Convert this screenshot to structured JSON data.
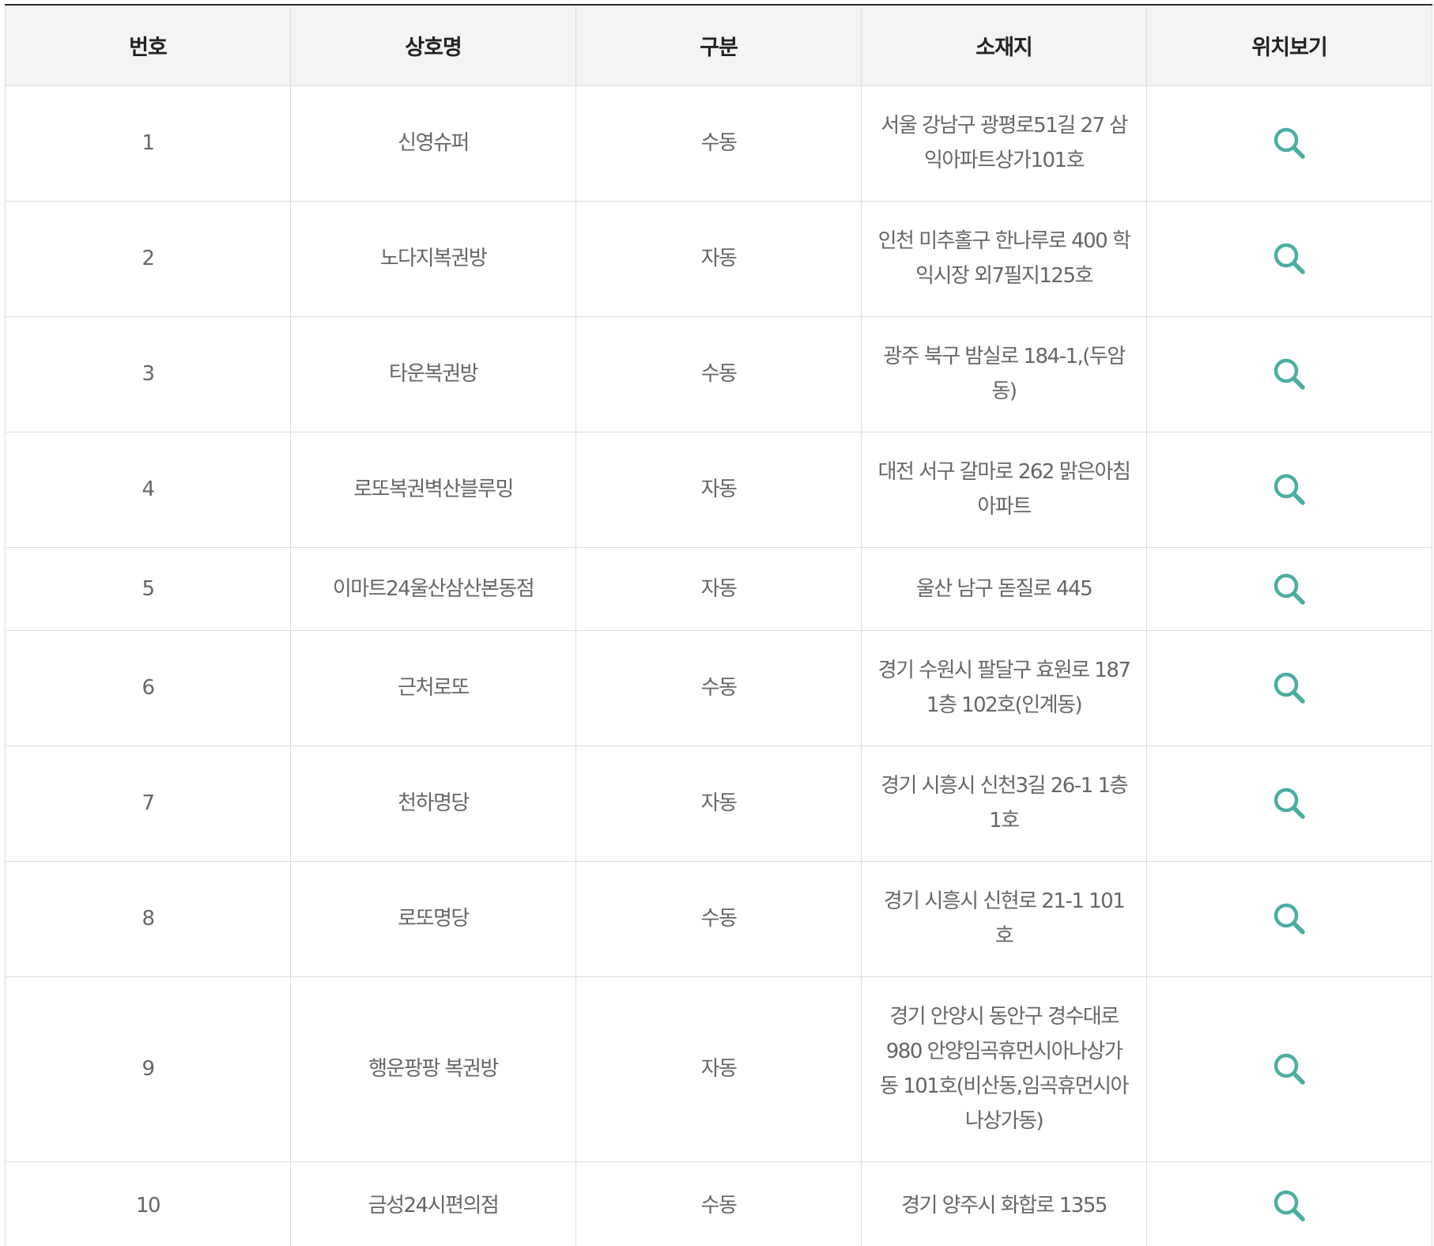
{
  "table": {
    "headers": {
      "number": "번호",
      "name": "상호명",
      "type": "구분",
      "address": "소재지",
      "location": "위치보기"
    },
    "rows": [
      {
        "number": "1",
        "name": "신영슈퍼",
        "type": "수동",
        "address": "서울 강남구 광평로51길 27 삼익아파트상가101호"
      },
      {
        "number": "2",
        "name": "노다지복권방",
        "type": "자동",
        "address": "인천 미추홀구 한나루로 400 학익시장 외7필지125호"
      },
      {
        "number": "3",
        "name": "타운복권방",
        "type": "수동",
        "address": "광주 북구 밤실로 184-1,(두암동)"
      },
      {
        "number": "4",
        "name": "로또복권벽산블루밍",
        "type": "자동",
        "address": "대전 서구 갈마로 262 맑은아침아파트"
      },
      {
        "number": "5",
        "name": "이마트24울산삼산본동점",
        "type": "자동",
        "address": "울산 남구 돋질로 445"
      },
      {
        "number": "6",
        "name": "근처로또",
        "type": "수동",
        "address": "경기 수원시 팔달구 효원로 187 1층 102호(인계동)"
      },
      {
        "number": "7",
        "name": "천하명당",
        "type": "자동",
        "address": "경기 시흥시 신천3길 26-1 1층 1호"
      },
      {
        "number": "8",
        "name": "로또명당",
        "type": "수동",
        "address": "경기 시흥시 신현로 21-1 101호"
      },
      {
        "number": "9",
        "name": "행운팡팡 복권방",
        "type": "자동",
        "address": "경기 안양시 동안구 경수대로 980 안양임곡휴먼시아나상가동 101호(비산동,임곡휴먼시아 나상가동)"
      },
      {
        "number": "10",
        "name": "금성24시편의점",
        "type": "수동",
        "address": "경기 양주시 화합로 1355"
      }
    ]
  },
  "icons": {
    "location": "search-icon"
  },
  "colors": {
    "accent": "#4aaea1",
    "header_bg": "#f4f4f4",
    "border": "#dcdcdc",
    "text": "#666666",
    "header_text": "#222222"
  }
}
